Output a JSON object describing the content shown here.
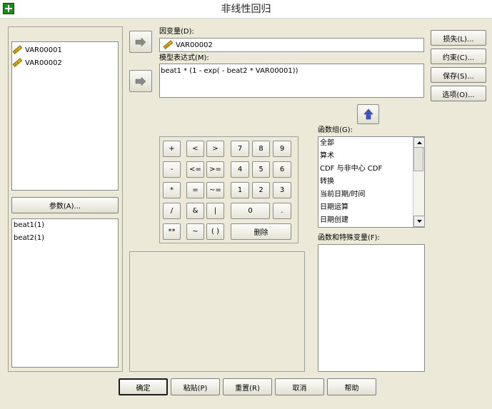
{
  "window": {
    "title": "非线性回归"
  },
  "variables": [
    "VAR00001",
    "VAR00002"
  ],
  "dependent": {
    "label": "因变量(D):",
    "value": "VAR00002"
  },
  "expression": {
    "label": "模型表达式(M):",
    "value": "beat1 * (1 - exp( - beat2 * VAR00001))"
  },
  "parameters": {
    "button": "参数(A)...",
    "items": [
      "beat1(1)",
      "beat2(1)"
    ]
  },
  "right_buttons": [
    "损失(L)...",
    "约束(C)...",
    "保存(S)...",
    "选项(O)..."
  ],
  "calculator": {
    "keys": {
      "plus": "+",
      "lt": "<",
      "gt": ">",
      "seven": "7",
      "eight": "8",
      "nine": "9",
      "minus": "-",
      "le": "<=",
      "ge": ">=",
      "four": "4",
      "five": "5",
      "six": "6",
      "times": "*",
      "eq": "=",
      "ne": "~=",
      "one": "1",
      "two": "2",
      "three": "3",
      "divide": "/",
      "and": "&",
      "or": "|",
      "zero": "0",
      "dot": ".",
      "power": "**",
      "not": "~",
      "parens": "( )",
      "delete": "删除"
    }
  },
  "function_group": {
    "label": "函数组(G):",
    "items": [
      "全部",
      "算术",
      "CDF 与非中心 CDF",
      "转换",
      "当前日期/时间",
      "日期运算",
      "日期创建"
    ]
  },
  "functions_special": {
    "label": "函数和特殊变量(F):"
  },
  "bottom_buttons": [
    "确定",
    "粘贴(P)",
    "重置(R)",
    "取消",
    "帮助"
  ]
}
